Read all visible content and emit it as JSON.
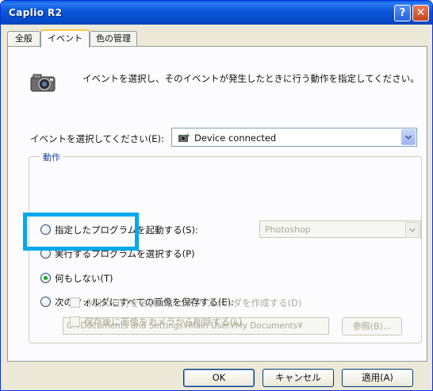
{
  "window": {
    "title": "Caplio R2"
  },
  "titlebar": {
    "help_glyph": "?",
    "close_glyph": "✕"
  },
  "tabs": [
    {
      "label": "全般"
    },
    {
      "label": "イベント"
    },
    {
      "label": "色の管理"
    }
  ],
  "panel": {
    "description": "イベントを選択し、そのイベントが発生したときに行う動作を指定してください。",
    "event_label": "イベントを選択してください(E):",
    "event_value": "Device connected",
    "group_title": "動作",
    "options": [
      {
        "label": "指定したプログラムを起動する(S):",
        "selected": false,
        "enabled": true
      },
      {
        "label": "実行するプログラムを選択する(P)",
        "selected": false,
        "enabled": true
      },
      {
        "label": "何もしない(T)",
        "selected": true,
        "enabled": true
      },
      {
        "label": "次のフォルダにすべての画像を保存する(E):",
        "selected": false,
        "enabled": true
      }
    ],
    "program_value": "Photoshop",
    "folder_path": "C:¥Documents and Settings¥Main User¥My Documents¥",
    "browse_label": "参照(B)...",
    "checkboxes": [
      {
        "label": "今日の日付を名前にしたサブ フォルダを作成する(D)",
        "checked": false,
        "enabled": false
      },
      {
        "label": "保存後に画像をカメラから削除する(L)",
        "checked": false,
        "enabled": false
      }
    ]
  },
  "buttons": {
    "ok": "OK",
    "cancel": "キャンセル",
    "apply": "適用(A)"
  },
  "colors": {
    "titlebar": "#0b58d8",
    "highlight": "#00a8ec",
    "window_bg": "#ece9d8"
  }
}
